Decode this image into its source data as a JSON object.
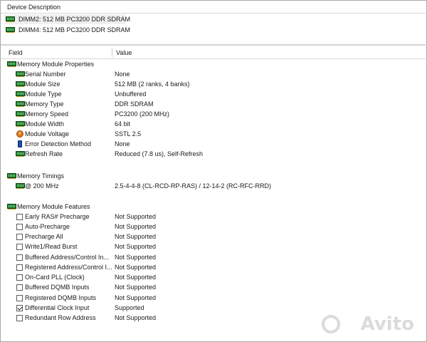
{
  "device_header": {
    "label": "Device Description"
  },
  "devices": [
    {
      "label": "DIMM2: 512 MB PC3200 DDR SDRAM",
      "icon": "memory-module-icon"
    },
    {
      "label": "DIMM4: 512 MB PC3200 DDR SDRAM",
      "icon": "memory-module-icon"
    }
  ],
  "props_header": {
    "field": "Field",
    "value": "Value"
  },
  "groups": {
    "properties": {
      "title": "Memory Module Properties",
      "items": [
        {
          "field": "Serial Number",
          "value": "None"
        },
        {
          "field": "Module Size",
          "value": "512 MB (2 ranks, 4 banks)"
        },
        {
          "field": "Module Type",
          "value": "Unbuffered"
        },
        {
          "field": "Memory Type",
          "value": "DDR SDRAM"
        },
        {
          "field": "Memory Speed",
          "value": "PC3200 (200 MHz)"
        },
        {
          "field": "Module Width",
          "value": "64 bit"
        },
        {
          "field": "Module Voltage",
          "value": "SSTL 2.5"
        },
        {
          "field": "Error Detection Method",
          "value": "None"
        },
        {
          "field": "Refresh Rate",
          "value": "Reduced (7.8 us), Self-Refresh"
        }
      ]
    },
    "timings": {
      "title": "Memory Timings",
      "items": [
        {
          "field": "@ 200 MHz",
          "value": "2.5-4-4-8  (CL-RCD-RP-RAS) / 12-14-2  (RC-RFC-RRD)"
        }
      ]
    },
    "features": {
      "title": "Memory Module Features",
      "items": [
        {
          "field": "Early RAS# Precharge",
          "value": "Not Supported",
          "checked": false
        },
        {
          "field": "Auto-Precharge",
          "value": "Not Supported",
          "checked": false
        },
        {
          "field": "Precharge All",
          "value": "Not Supported",
          "checked": false
        },
        {
          "field": "Write1/Read Burst",
          "value": "Not Supported",
          "checked": false
        },
        {
          "field": "Buffered Address/Control In...",
          "value": "Not Supported",
          "checked": false
        },
        {
          "field": "Registered Address/Control I...",
          "value": "Not Supported",
          "checked": false
        },
        {
          "field": "On-Card PLL (Clock)",
          "value": "Not Supported",
          "checked": false
        },
        {
          "field": "Buffered DQMB Inputs",
          "value": "Not Supported",
          "checked": false
        },
        {
          "field": "Registered DQMB Inputs",
          "value": "Not Supported",
          "checked": false
        },
        {
          "field": "Differential Clock Input",
          "value": "Supported",
          "checked": true
        },
        {
          "field": "Redundant Row Address",
          "value": "Not Supported",
          "checked": false
        }
      ]
    }
  },
  "watermark": {
    "text": "Avito"
  },
  "colors": {
    "module_icon": "#1f7a2c",
    "voltage_icon": "#e07b16",
    "selection": "#e8e8e8"
  }
}
